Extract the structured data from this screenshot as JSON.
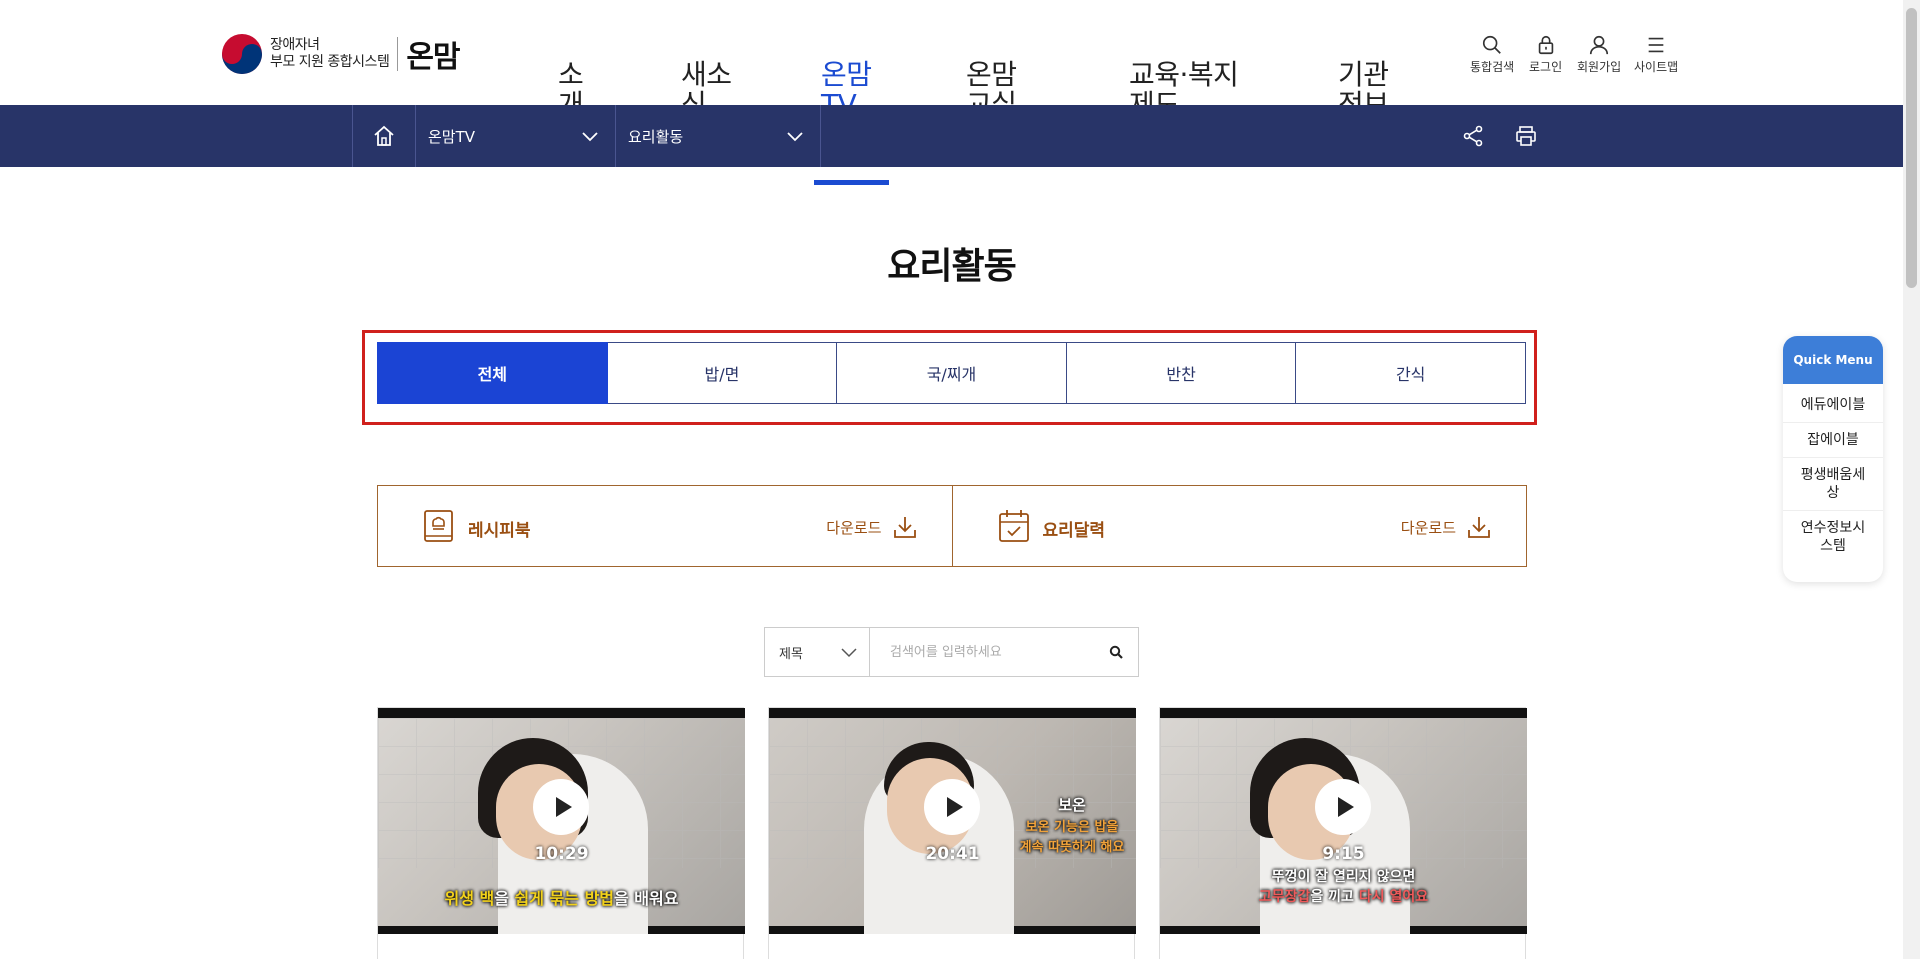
{
  "header": {
    "logo_line1": "장애자녀",
    "logo_line2": "부모 지원 종합시스템",
    "brand": "온맘",
    "nav": [
      {
        "label": "소개"
      },
      {
        "label": "새소식"
      },
      {
        "label": "온맘TV"
      },
      {
        "label": "온맘교실"
      },
      {
        "label": "교육·복지제도"
      },
      {
        "label": "기관정보"
      }
    ],
    "utils": {
      "search": "통합검색",
      "login": "로그인",
      "join": "회원가입",
      "sitemap": "사이트맵"
    }
  },
  "subnav": {
    "depth1": "온맘TV",
    "depth2": "요리활동"
  },
  "page": {
    "title": "요리활동"
  },
  "tabs": [
    {
      "label": "전체",
      "active": true
    },
    {
      "label": "밥/면",
      "active": false
    },
    {
      "label": "국/찌개",
      "active": false
    },
    {
      "label": "반찬",
      "active": false
    },
    {
      "label": "간식",
      "active": false
    }
  ],
  "downloads": [
    {
      "label": "레시피북",
      "action": "다운로드"
    },
    {
      "label": "요리달력",
      "action": "다운로드"
    }
  ],
  "search": {
    "field": "제목",
    "placeholder": "검색어를 입력하세요"
  },
  "videos": [
    {
      "duration": "10:29",
      "caption_1": "위생 백",
      "caption_2": "을 ",
      "caption_3": "쉽게 묶는 방법",
      "caption_4": "을 배워요"
    },
    {
      "duration": "20:41",
      "caption_title": "보온",
      "caption_line1": "보온 기능은 밥을",
      "caption_line2": "계속 따뜻하게 해요"
    },
    {
      "duration": "9:15",
      "caption_line1": "뚜껑이 잘 열리지 않으면",
      "caption_2a": "고무장갑",
      "caption_2b": "을 끼고 ",
      "caption_2c": "다시 열어요"
    }
  ],
  "quick_menu": {
    "title": "Quick Menu",
    "items": [
      "에듀에이블",
      "잡에이블",
      "평생배움세상",
      "연수정보시스템"
    ]
  },
  "colors": {
    "primary": "#1b44d4",
    "navy": "#283468",
    "brown": "#9a4f12",
    "highlight": "#d0201c"
  }
}
